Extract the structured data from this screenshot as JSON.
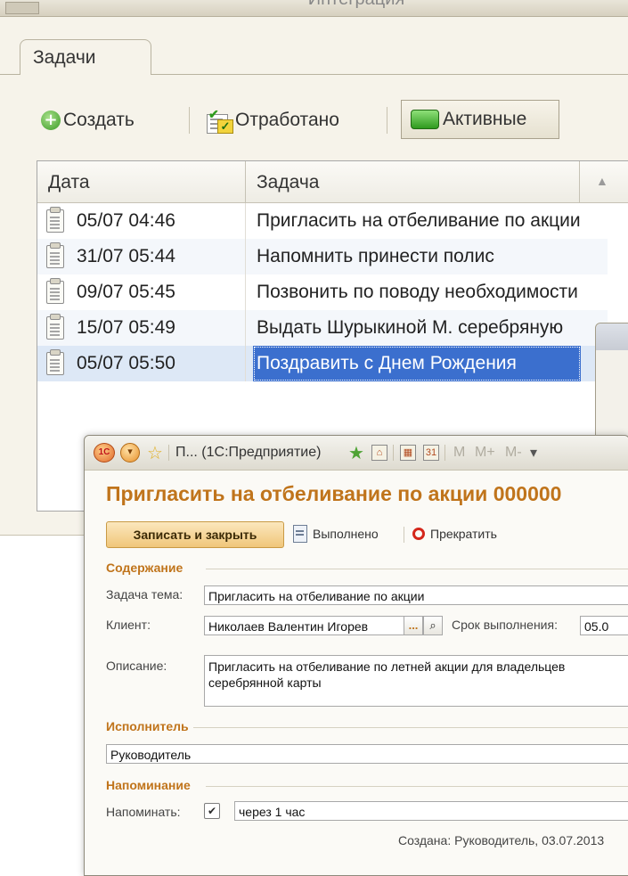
{
  "main_window": {
    "title_fragment": "Интеграция",
    "tab_label": "Задачи",
    "toolbar": {
      "create_label": "Создать",
      "worked_label": "Отработано",
      "active_label": "Активные"
    },
    "table": {
      "columns": [
        "Дата",
        "Задача"
      ],
      "rows": [
        {
          "date": "05/07 04:46",
          "task": "Пригласить на отбеливание по акции"
        },
        {
          "date": "31/07 05:44",
          "task": "Напомнить принести полис"
        },
        {
          "date": "09/07 05:45",
          "task": "Позвонить по поводу необходимости"
        },
        {
          "date": "15/07 05:49",
          "task": "Выдать Шурыкиной М. серебряную"
        },
        {
          "date": "05/07 05:50",
          "task": "Поздравить с Днем Рождения"
        }
      ],
      "selected_index": 4
    }
  },
  "task_window": {
    "titlebar": {
      "app_name": "П... (1С:Предприятие)",
      "m_label": "M",
      "mplus_label": "M+",
      "mminus_label": "M-"
    },
    "title": "Пригласить на отбеливание по акции 000000",
    "toolbar": {
      "save_close_label": "Записать и закрыть",
      "done_label": "Выполнено",
      "stop_label": "Прекратить"
    },
    "sections": {
      "content": "Содержание",
      "executor": "Исполнитель",
      "reminder": "Напоминание"
    },
    "fields": {
      "topic_label": "Задача тема:",
      "topic_value": "Пригласить на отбеливание по акции",
      "client_label": "Клиент:",
      "client_value": "Николаев Валентин Игорев",
      "client_select": "...",
      "due_label": "Срок выполнения:",
      "due_value": "05.0",
      "description_label": "Описание:",
      "description_value": "Пригласить на отбеливание по летней акции для владельцев серебрянной карты",
      "executor_value": "Руководитель",
      "remind_label": "Напоминать:",
      "remind_checked": true,
      "remind_value": "через 1 час"
    },
    "footer": "Создана: Руководитель, 03.07.2013"
  }
}
